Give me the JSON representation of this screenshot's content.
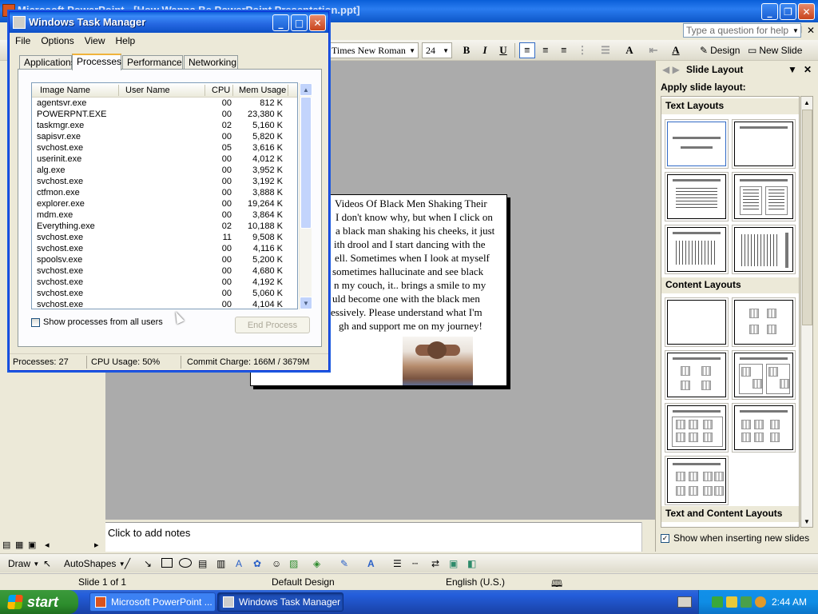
{
  "powerpoint": {
    "title": "Microsoft PowerPoint - [How Wanna Be PowerPoint Presentation.ppt]",
    "help_placeholder": "Type a question for help",
    "font_name": "Times New Roman",
    "font_size": "24",
    "design_label": "Design",
    "new_slide_label": "New Slide",
    "slide_lines": [
      "Videos Of Black Men Shaking Their",
      "I don't know why, but when I click on",
      "a black man shaking his cheeks, it just",
      "ith drool and I start dancing with the",
      "ell. Sometimes when I look at myself",
      "sometimes hallucinate and see black",
      "n my couch, it.. brings a smile to my",
      "uld become one with the black men",
      "essively. Please understand what I'm",
      "gh and support me on my journey!"
    ],
    "notes_placeholder": "Click to add notes",
    "draw_label": "Draw",
    "autoshapes_label": "AutoShapes",
    "status": {
      "slide": "Slide 1 of 1",
      "design": "Default Design",
      "language": "English (U.S.)"
    }
  },
  "taskpane": {
    "title": "Slide Layout",
    "apply_label": "Apply slide layout:",
    "sections": [
      "Text Layouts",
      "Content Layouts",
      "Text and Content Layouts"
    ],
    "show_when_inserting": "Show when inserting new slides",
    "show_when_inserting_checked": true
  },
  "task_manager": {
    "title": "Windows Task Manager",
    "menu": [
      "File",
      "Options",
      "View",
      "Help"
    ],
    "tabs": [
      "Applications",
      "Processes",
      "Performance",
      "Networking"
    ],
    "active_tab": "Processes",
    "columns": [
      "Image Name",
      "User Name",
      "CPU",
      "Mem Usage"
    ],
    "processes": [
      {
        "name": "agentsvr.exe",
        "cpu": "00",
        "mem": "812 K"
      },
      {
        "name": "POWERPNT.EXE",
        "cpu": "00",
        "mem": "23,380 K"
      },
      {
        "name": "taskmgr.exe",
        "cpu": "02",
        "mem": "5,160 K"
      },
      {
        "name": "sapisvr.exe",
        "cpu": "00",
        "mem": "5,820 K"
      },
      {
        "name": "svchost.exe",
        "cpu": "05",
        "mem": "3,616 K"
      },
      {
        "name": "userinit.exe",
        "cpu": "00",
        "mem": "4,012 K"
      },
      {
        "name": "alg.exe",
        "cpu": "00",
        "mem": "3,952 K"
      },
      {
        "name": "svchost.exe",
        "cpu": "00",
        "mem": "3,192 K"
      },
      {
        "name": "ctfmon.exe",
        "cpu": "00",
        "mem": "3,888 K"
      },
      {
        "name": "explorer.exe",
        "cpu": "00",
        "mem": "19,264 K"
      },
      {
        "name": "mdm.exe",
        "cpu": "00",
        "mem": "3,864 K"
      },
      {
        "name": "Everything.exe",
        "cpu": "02",
        "mem": "10,188 K"
      },
      {
        "name": "svchost.exe",
        "cpu": "11",
        "mem": "9,508 K"
      },
      {
        "name": "svchost.exe",
        "cpu": "00",
        "mem": "4,116 K"
      },
      {
        "name": "spoolsv.exe",
        "cpu": "00",
        "mem": "5,200 K"
      },
      {
        "name": "svchost.exe",
        "cpu": "00",
        "mem": "4,680 K"
      },
      {
        "name": "svchost.exe",
        "cpu": "00",
        "mem": "4,192 K"
      },
      {
        "name": "svchost.exe",
        "cpu": "00",
        "mem": "5,060 K"
      },
      {
        "name": "svchost.exe",
        "cpu": "00",
        "mem": "4,104 K"
      }
    ],
    "show_all_users": "Show processes from all users",
    "end_process": "End Process",
    "status": {
      "processes": "Processes: 27",
      "cpu": "CPU Usage: 50%",
      "commit": "Commit Charge: 166M / 3679M"
    }
  },
  "taskbar": {
    "start": "start",
    "tasks": [
      "Microsoft PowerPoint ...",
      "Windows Task Manager"
    ],
    "clock": "2:44 AM"
  }
}
